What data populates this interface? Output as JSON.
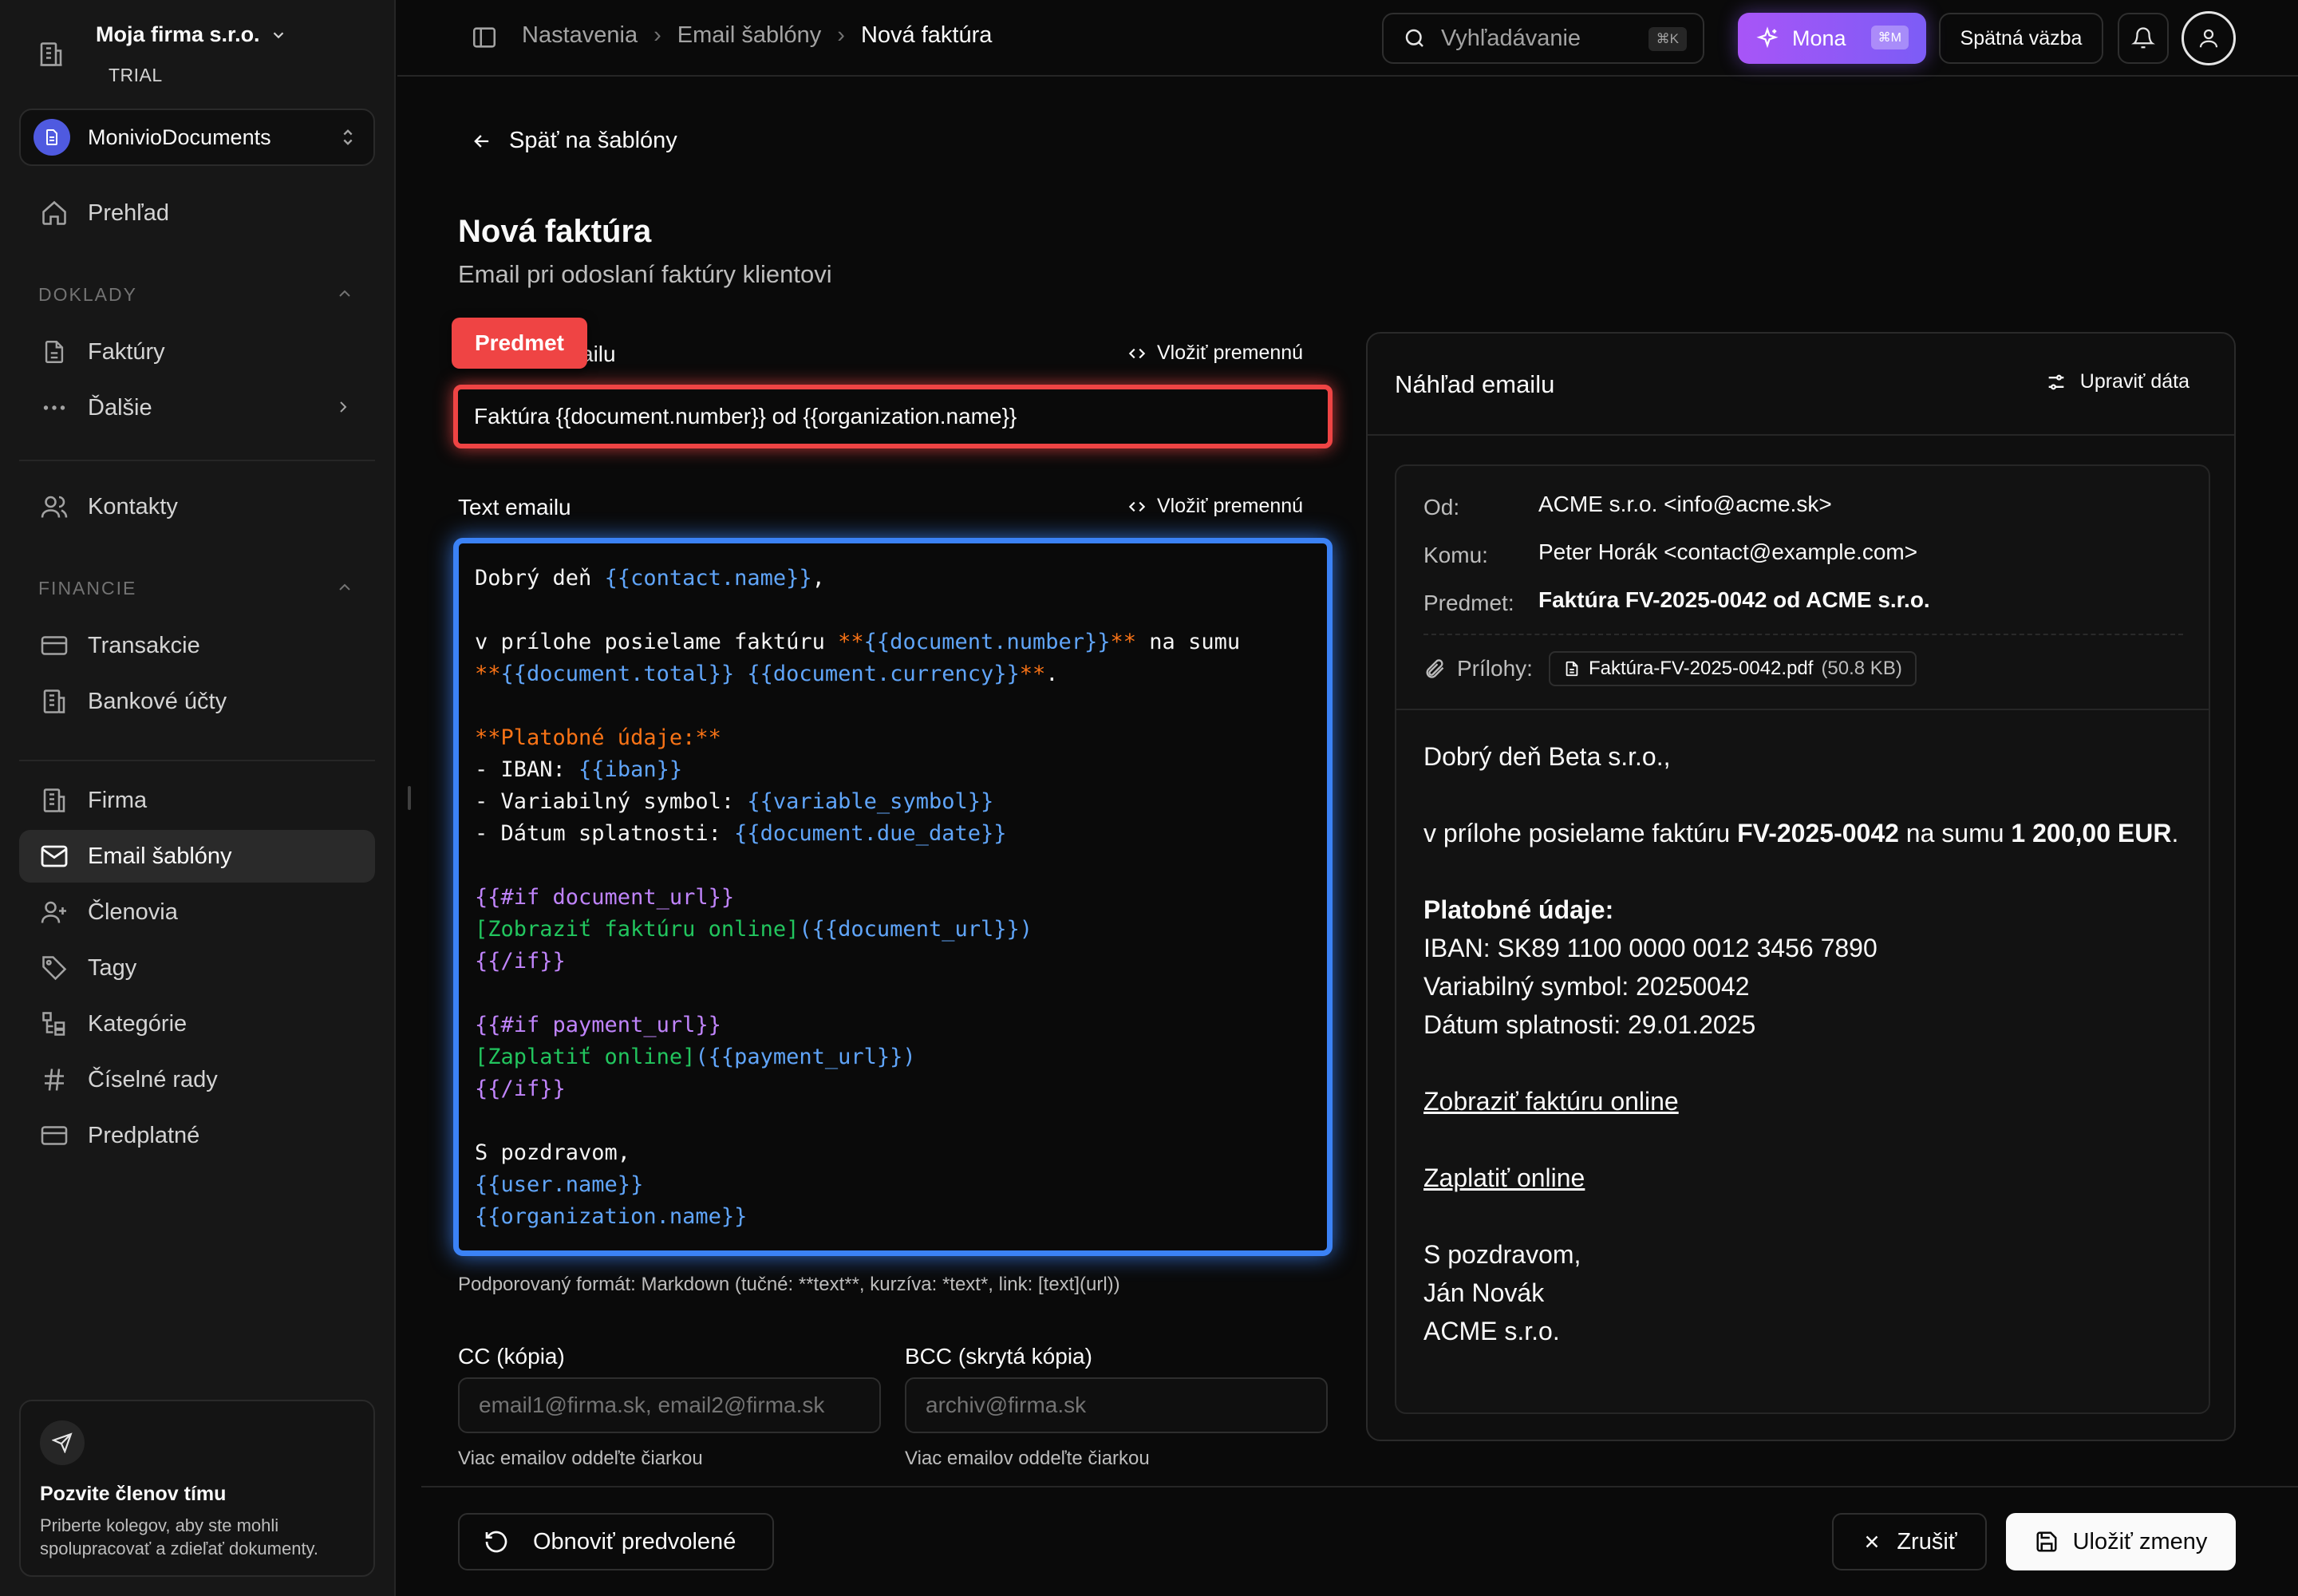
{
  "sidebar": {
    "org_name": "Moja firma s.r.o.",
    "org_plan": "TRIAL",
    "app_name": "MonivioDocuments",
    "nav_top": [
      {
        "label": "Prehľad",
        "icon": "home-icon"
      }
    ],
    "section_doklady": "DOKLADY",
    "nav_doklady": [
      {
        "label": "Faktúry",
        "icon": "document-icon"
      },
      {
        "label": "Ďalšie",
        "icon": "more-icon"
      }
    ],
    "nav_contacts": [
      {
        "label": "Kontakty",
        "icon": "users-icon"
      }
    ],
    "section_financie": "FINANCIE",
    "nav_financie": [
      {
        "label": "Transakcie",
        "icon": "card-icon"
      },
      {
        "label": "Bankové účty",
        "icon": "bank-icon"
      }
    ],
    "nav_settings": [
      {
        "label": "Firma",
        "icon": "building-icon"
      },
      {
        "label": "Email šablóny",
        "icon": "mail-icon",
        "active": true
      },
      {
        "label": "Členovia",
        "icon": "user-plus-icon"
      },
      {
        "label": "Tagy",
        "icon": "tag-icon"
      },
      {
        "label": "Kategórie",
        "icon": "category-icon"
      },
      {
        "label": "Číselné rady",
        "icon": "hash-icon"
      },
      {
        "label": "Predplatné",
        "icon": "card-icon"
      }
    ],
    "invite": {
      "title": "Pozvite členov tímu",
      "text_line1": "Priberte kolegov, aby ste mohli",
      "text_line2": "spolupracovať a zdieľať dokumenty."
    }
  },
  "topbar": {
    "breadcrumbs": [
      "Nastavenia",
      "Email šablóny",
      "Nová faktúra"
    ],
    "search_placeholder": "Vyhľadávanie",
    "search_shortcut": "⌘K",
    "mona_label": "Mona",
    "mona_shortcut": "⌘M",
    "feedback_label": "Spätná väzba"
  },
  "main": {
    "back_label": "Späť na šablóny",
    "title": "Nová faktúra",
    "subtitle": "Email pri odoslaní faktúry klientovi",
    "subject_label_tail": "ailu",
    "subject_badge": "Predmet",
    "insert_variable": "Vložiť premennú",
    "subject_value": "Faktúra {{document.number}} od {{organization.name}}",
    "body_label": "Text emailu",
    "body_lines": [
      [
        [
          "t",
          "Dobrý deň "
        ],
        [
          "v",
          "{{contact.name}}"
        ],
        [
          "t",
          ","
        ]
      ],
      [],
      [
        [
          "t",
          "v prílohe posielame faktúru "
        ],
        [
          "b",
          "**"
        ],
        [
          "v",
          "{{document.number}}"
        ],
        [
          "b",
          "**"
        ],
        [
          "t",
          " na sumu"
        ]
      ],
      [
        [
          "b",
          "**"
        ],
        [
          "v",
          "{{document.total}}"
        ],
        [
          "t",
          " "
        ],
        [
          "v",
          "{{document.currency}}"
        ],
        [
          "b",
          "**"
        ],
        [
          "t",
          "."
        ]
      ],
      [],
      [
        [
          "b",
          "**Platobné údaje:**"
        ]
      ],
      [
        [
          "t",
          "- IBAN: "
        ],
        [
          "v",
          "{{iban}}"
        ]
      ],
      [
        [
          "t",
          "- Variabilný symbol: "
        ],
        [
          "v",
          "{{variable_symbol}}"
        ]
      ],
      [
        [
          "t",
          "- Dátum splatnosti: "
        ],
        [
          "v",
          "{{document.due_date}}"
        ]
      ],
      [],
      [
        [
          "i",
          "{{#if document_url}}"
        ]
      ],
      [
        [
          "l",
          "[Zobraziť faktúru online]"
        ],
        [
          "v",
          "({{document_url}})"
        ]
      ],
      [
        [
          "i",
          "{{/if}}"
        ]
      ],
      [],
      [
        [
          "i",
          "{{#if payment_url}}"
        ]
      ],
      [
        [
          "l",
          "[Zaplatiť online]"
        ],
        [
          "v",
          "({{payment_url}})"
        ]
      ],
      [
        [
          "i",
          "{{/if}}"
        ]
      ],
      [],
      [
        [
          "t",
          "S pozdravom,"
        ]
      ],
      [
        [
          "v",
          "{{user.name}}"
        ]
      ],
      [
        [
          "v",
          "{{organization.name}}"
        ]
      ]
    ],
    "format_hint": "Podporovaný formát: Markdown (tučné: **text**, kurzíva: *text*, link: [text](url))",
    "cc_label": "CC (kópia)",
    "cc_placeholder": "email1@firma.sk, email2@firma.sk",
    "cc_hint": "Viac emailov oddeľte čiarkou",
    "bcc_label": "BCC (skrytá kópia)",
    "bcc_placeholder": "archiv@firma.sk",
    "bcc_hint": "Viac emailov oddeľte čiarkou",
    "reset_label": "Obnoviť predvolené",
    "cancel_label": "Zrušiť",
    "save_label": "Uložiť zmeny"
  },
  "preview": {
    "title": "Náhľad emailu",
    "edit_data": "Upraviť dáta",
    "from_key": "Od:",
    "from_value": "ACME s.r.o. <info@acme.sk>",
    "to_key": "Komu:",
    "to_value": "Peter Horák <contact@example.com>",
    "subject_key": "Predmet:",
    "subject_value": "Faktúra FV-2025-0042 od ACME s.r.o.",
    "attachments_key": "Prílohy:",
    "attachment_name": "Faktúra-FV-2025-0042.pdf",
    "attachment_size": "(50.8 KB)",
    "greeting": "Dobrý deň Beta s.r.o.,",
    "intro_text": "v prílohe posielame faktúru ",
    "invoice_number": "FV-2025-0042",
    "intro_mid": " na sumu ",
    "amount": "1 200,00 EUR",
    "intro_end": ".",
    "payment_heading": "Platobné údaje:",
    "iban_line": "IBAN: SK89 1100 0000 0012 3456 7890",
    "vs_line": "Variabilný symbol: 20250042",
    "due_line": "Dátum splatnosti: 29.01.2025",
    "view_link": "Zobraziť faktúru online",
    "pay_link": "Zaplatiť online",
    "closing": "S pozdravom,",
    "signer": "Ján Novák",
    "company": "ACME s.r.o."
  },
  "colors": {
    "accent_red": "#ef4444",
    "accent_blue": "#3b82f6",
    "mona_gradient_start": "#a855f7",
    "mona_gradient_end": "#7c5cf6",
    "var_color": "#60a5fa",
    "bold_color": "#f97316",
    "if_color": "#c084fc",
    "link_color": "#22c55e"
  }
}
